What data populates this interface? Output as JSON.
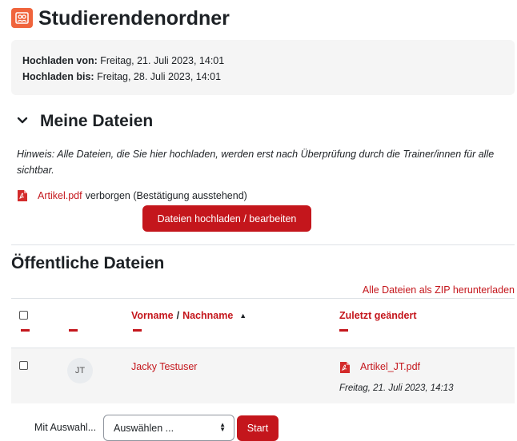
{
  "header": {
    "title": "Studierendenordner",
    "icon": "folder-users-icon",
    "icon_color": "#f0643c"
  },
  "dates": {
    "from_label": "Hochladen von:",
    "from_value": "Freitag, 21. Juli 2023, 14:01",
    "to_label": "Hochladen bis:",
    "to_value": "Freitag, 28. Juli 2023, 14:01"
  },
  "my_files": {
    "title": "Meine Dateien",
    "hint": "Hinweis: Alle Dateien, die Sie hier hochladen, werden erst nach Überprüfung durch die Trainer/innen für alle sichtbar.",
    "file_name": "Artikel.pdf",
    "file_status": "verborgen (Bestätigung ausstehend)",
    "upload_button": "Dateien hochladen / bearbeiten"
  },
  "public_files": {
    "title": "Öffentliche Dateien",
    "zip_link": "Alle Dateien als ZIP herunterladen",
    "columns": {
      "firstname": "Vorname",
      "separator": "/",
      "lastname": "Nachname",
      "modified": "Zuletzt geändert"
    },
    "rows": [
      {
        "initials": "JT",
        "name": "Jacky Testuser",
        "file": "Artikel_JT.pdf",
        "modified": "Freitag, 21. Juli 2023, 14:13"
      }
    ]
  },
  "bulk": {
    "label": "Mit Auswahl...",
    "select_value": "Auswählen ...",
    "start_button": "Start"
  },
  "colors": {
    "accent": "#c4161c",
    "box_bg": "#f5f5f5"
  }
}
